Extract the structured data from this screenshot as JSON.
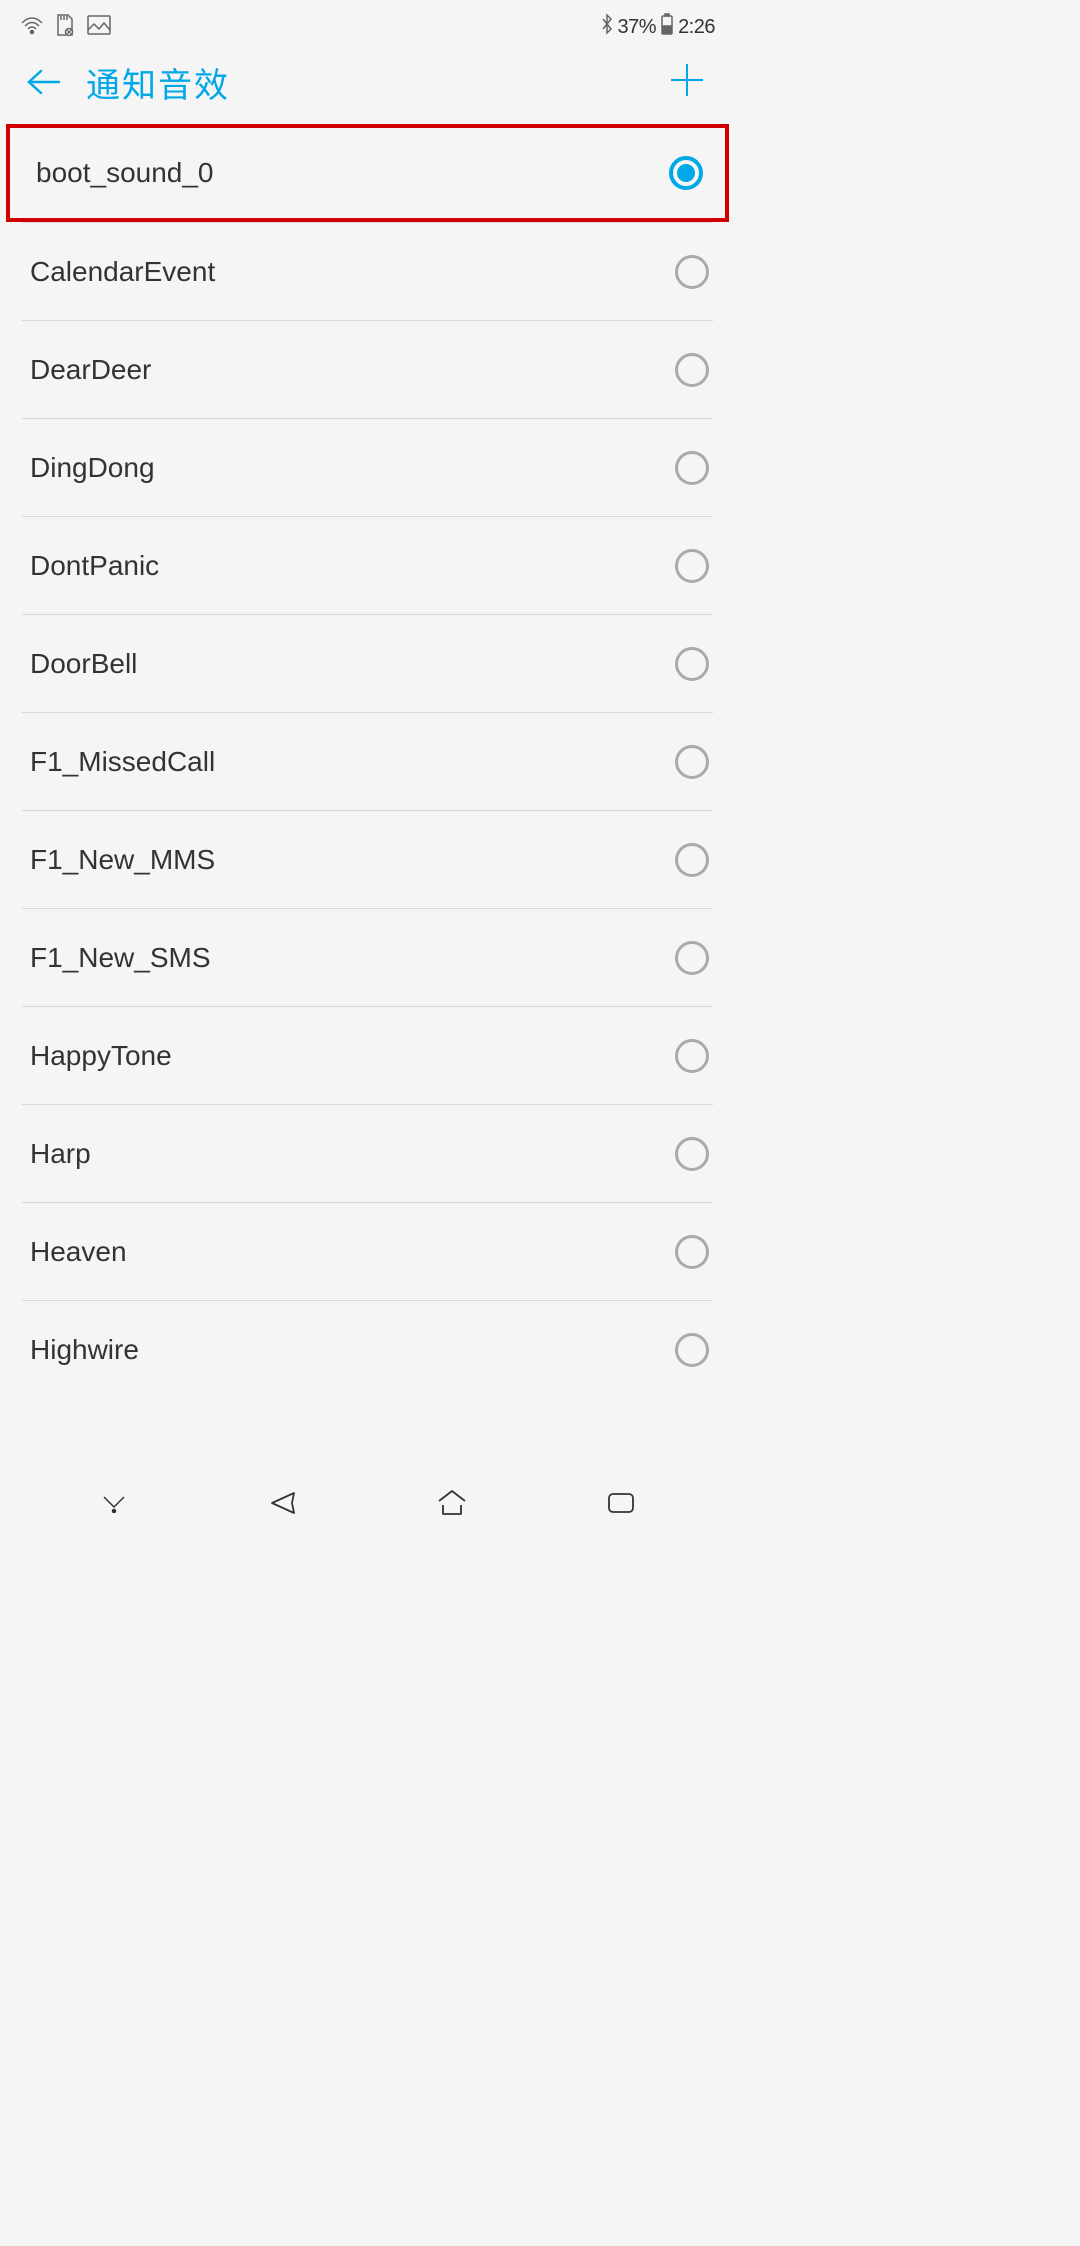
{
  "statusBar": {
    "battery": "37%",
    "time": "2:26"
  },
  "header": {
    "title": "通知音效"
  },
  "sounds": [
    {
      "label": "boot_sound_0",
      "selected": true,
      "highlighted": true
    },
    {
      "label": "CalendarEvent",
      "selected": false,
      "highlighted": false
    },
    {
      "label": "DearDeer",
      "selected": false,
      "highlighted": false
    },
    {
      "label": "DingDong",
      "selected": false,
      "highlighted": false
    },
    {
      "label": "DontPanic",
      "selected": false,
      "highlighted": false
    },
    {
      "label": "DoorBell",
      "selected": false,
      "highlighted": false
    },
    {
      "label": "F1_MissedCall",
      "selected": false,
      "highlighted": false
    },
    {
      "label": "F1_New_MMS",
      "selected": false,
      "highlighted": false
    },
    {
      "label": "F1_New_SMS",
      "selected": false,
      "highlighted": false
    },
    {
      "label": "HappyTone",
      "selected": false,
      "highlighted": false
    },
    {
      "label": "Harp",
      "selected": false,
      "highlighted": false
    },
    {
      "label": "Heaven",
      "selected": false,
      "highlighted": false
    },
    {
      "label": "Highwire",
      "selected": false,
      "highlighted": false
    }
  ],
  "colors": {
    "accent": "#00a8e8",
    "highlight": "#d10000"
  }
}
